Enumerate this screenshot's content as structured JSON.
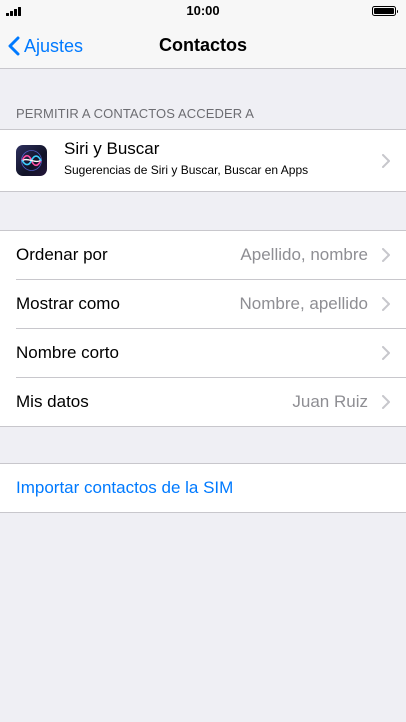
{
  "status_bar": {
    "time": "10:00"
  },
  "nav": {
    "back_label": "Ajustes",
    "title": "Contactos"
  },
  "section_header": "PERMITIR A CONTACTOS ACCEDER A",
  "siri": {
    "title": "Siri y Buscar",
    "subtitle": "Sugerencias de Siri y Buscar, Buscar en Apps"
  },
  "settings": [
    {
      "label": "Ordenar por",
      "value": "Apellido, nombre"
    },
    {
      "label": "Mostrar como",
      "value": "Nombre, apellido"
    },
    {
      "label": "Nombre corto",
      "value": ""
    },
    {
      "label": "Mis datos",
      "value": "Juan Ruiz"
    }
  ],
  "import_label": "Importar contactos de la SIM",
  "colors": {
    "accent": "#007aff",
    "background": "#efeff4",
    "secondary_text": "#8e8e93"
  }
}
